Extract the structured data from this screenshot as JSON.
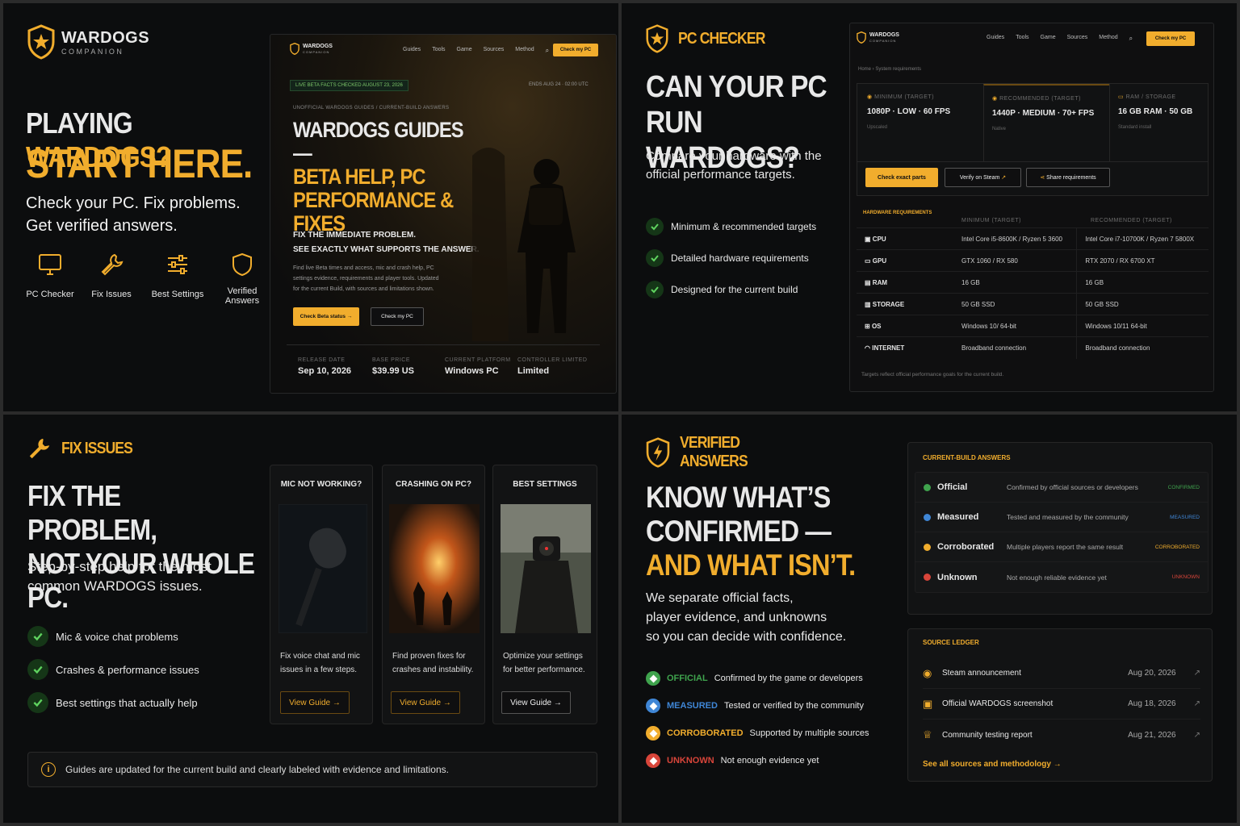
{
  "q1": {
    "brand": "WARDOGS",
    "brand_sub": "COMPANION",
    "head1a": "PLAYING ",
    "head1b": "WARDOGS?",
    "head2": "START HERE.",
    "sub1": "Check your PC. Fix problems.",
    "sub2": "Get verified answers.",
    "features": [
      {
        "label": "PC Checker",
        "icon": "monitor-icon"
      },
      {
        "label": "Fix Issues",
        "icon": "wrench-icon"
      },
      {
        "label": "Best Settings",
        "icon": "sliders-icon"
      },
      {
        "label": "Verified",
        "label2": "Answers",
        "icon": "shield-icon"
      }
    ],
    "mock": {
      "brand": "WARDOGS",
      "brand_sub": "COMPANION",
      "nav": [
        "Guides",
        "Tools",
        "Game",
        "Sources",
        "Method"
      ],
      "cta": "Check my PC",
      "badge": "LIVE BETA FACTS CHECKED AUGUST 23, 2026",
      "ends": "ENDS AUG 24 · 02:00 UTC",
      "kicker": "UNOFFICIAL WARDOGS GUIDES / CURRENT-BUILD ANSWERS",
      "title1": "WARDOGS GUIDES —",
      "title2": "BETA HELP, PC",
      "title3": "PERFORMANCE &",
      "title4": "FIXES",
      "sub1": "FIX THE IMMEDIATE PROBLEM.",
      "sub2": "SEE EXACTLY WHAT SUPPORTS THE ANSWER.",
      "body1": "Find live Beta times and access, mic and crash help, PC",
      "body2": "settings evidence, requirements and player tools. Updated",
      "body3": "for the current Build, with sources and limitations shown.",
      "btn1": "Check Beta status →",
      "btn2": "Check my PC",
      "stats": [
        {
          "k": "RELEASE DATE",
          "v": "Sep 10, 2026"
        },
        {
          "k": "BASE PRICE",
          "v": "$39.99 US"
        },
        {
          "k": "CURRENT PLATFORM",
          "v": "Windows PC"
        },
        {
          "k": "CONTROLLER LIMITED",
          "v": "Limited"
        }
      ]
    }
  },
  "q2": {
    "tag": "PC CHECKER",
    "head1": "CAN YOUR PC",
    "head2": "RUN WARDOGS?",
    "sub1": "Compare your hardware with the",
    "sub2": "official performance targets.",
    "checks": [
      "Minimum & recommended targets",
      "Detailed hardware requirements",
      "Designed for the current build"
    ],
    "mock": {
      "brand": "WARDOGS",
      "brand_sub": "COMPANION",
      "nav": [
        "Guides",
        "Tools",
        "Game",
        "Sources",
        "Method"
      ],
      "cta": "Check my PC",
      "crumb1": "Home",
      "crumb2": "System requirements",
      "targets": [
        {
          "k": "MINIMUM (TARGET)",
          "v": "1080P · LOW · 60 FPS",
          "n": "Upscaled"
        },
        {
          "k": "RECOMMENDED (TARGET)",
          "v": "1440P · MEDIUM · 70+ FPS",
          "n": "Native"
        },
        {
          "k": "RAM / STORAGE",
          "v": "16 GB RAM · 50 GB",
          "n": "Standard install"
        }
      ],
      "btn1": "Check exact parts",
      "btn2": "Verify on Steam",
      "btn3": "Share requirements",
      "hw_title": "HARDWARE REQUIREMENTS",
      "col_min": "MINIMUM (TARGET)",
      "col_rec": "RECOMMENDED (TARGET)",
      "rows": [
        {
          "k": "CPU",
          "min": "Intel Core i5-8600K / Ryzen 5 3600",
          "rec": "Intel Core i7-10700K / Ryzen 7 5800X"
        },
        {
          "k": "GPU",
          "min": "GTX 1060 / RX 580",
          "rec": "RTX 2070 / RX 6700 XT"
        },
        {
          "k": "RAM",
          "min": "16 GB",
          "rec": "16 GB"
        },
        {
          "k": "STORAGE",
          "min": "50 GB SSD",
          "rec": "50 GB SSD"
        },
        {
          "k": "OS",
          "min": "Windows 10/ 64-bit",
          "rec": "Windows 10/11 64-bit"
        },
        {
          "k": "INTERNET",
          "min": "Broadband connection",
          "rec": "Broadband connection"
        }
      ],
      "foot": "Targets reflect official performance goals for the current build."
    }
  },
  "q3": {
    "tag": "FIX ISSUES",
    "head1": "FIX THE PROBLEM,",
    "head2": "NOT YOUR WHOLE PC.",
    "sub1": "Step-by-step help for the most",
    "sub2": "common WARDOGS issues.",
    "checks": [
      "Mic & voice chat problems",
      "Crashes & performance issues",
      "Best settings that actually help"
    ],
    "cards": [
      {
        "title": "MIC NOT WORKING?",
        "d1": "Fix voice chat and mic",
        "d2": "issues in a few steps.",
        "btn": "View Guide →"
      },
      {
        "title": "CRASHING ON PC?",
        "d1": "Find proven fixes for",
        "d2": "crashes and instability.",
        "btn": "View Guide →"
      },
      {
        "title": "BEST SETTINGS",
        "d1": "Optimize your settings",
        "d2": "for better performance.",
        "btn": "View Guide →"
      }
    ],
    "note": "Guides are updated for the current build and clearly labeled with evidence and limitations."
  },
  "q4": {
    "tag": "VERIFIED ANSWERS",
    "head1": "KNOW WHAT’S",
    "head2": "CONFIRMED —",
    "head3": "AND WHAT ISN’T.",
    "sub1": "We separate official facts,",
    "sub2": "player evidence, and unknowns",
    "sub3": "so you can decide with confidence.",
    "legend": [
      {
        "k": "OFFICIAL",
        "v": "Confirmed by the game or developers",
        "color": "#3fa34d"
      },
      {
        "k": "MEASURED",
        "v": "Tested or verified by the community",
        "color": "#3f86d6"
      },
      {
        "k": "CORROBORATED",
        "v": "Supported by multiple sources",
        "color": "#f1ad2d"
      },
      {
        "k": "UNKNOWN",
        "v": "Not enough evidence yet",
        "color": "#d8453a"
      }
    ],
    "answers_title": "CURRENT-BUILD ANSWERS",
    "answers": [
      {
        "k": "Official",
        "v": "Confirmed by official sources or developers",
        "badge": "CONFIRMED",
        "color": "#3fa34d"
      },
      {
        "k": "Measured",
        "v": "Tested and measured by the community",
        "badge": "MEASURED",
        "color": "#3f86d6"
      },
      {
        "k": "Corroborated",
        "v": "Multiple players report the same result",
        "badge": "CORROBORATED",
        "color": "#f1ad2d"
      },
      {
        "k": "Unknown",
        "v": "Not enough reliable evidence yet",
        "badge": "UNKNOWN",
        "color": "#d8453a"
      }
    ],
    "ledger_title": "SOURCE LEDGER",
    "ledger": [
      {
        "k": "Steam announcement",
        "d": "Aug 20, 2026",
        "icon": "steam-icon"
      },
      {
        "k": "Official WARDOGS screenshot",
        "d": "Aug 18, 2026",
        "icon": "image-icon"
      },
      {
        "k": "Community testing report",
        "d": "Aug 21, 2026",
        "icon": "trophy-icon"
      }
    ],
    "ledger_link": "See all sources and methodology →"
  }
}
